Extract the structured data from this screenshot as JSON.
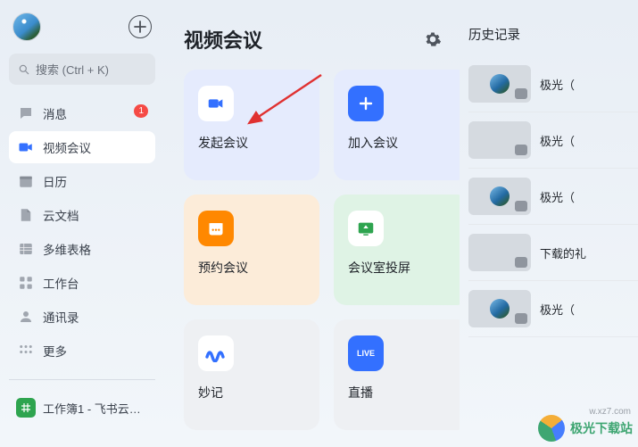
{
  "sidebar": {
    "search_placeholder": "搜索 (Ctrl + K)",
    "items": [
      {
        "label": "消息",
        "icon": "chat-icon",
        "badge": "1"
      },
      {
        "label": "视频会议",
        "icon": "video-icon",
        "active": true
      },
      {
        "label": "日历",
        "icon": "calendar-icon"
      },
      {
        "label": "云文档",
        "icon": "docs-icon"
      },
      {
        "label": "多维表格",
        "icon": "base-icon"
      },
      {
        "label": "工作台",
        "icon": "workplace-icon"
      },
      {
        "label": "通讯录",
        "icon": "contacts-icon"
      },
      {
        "label": "更多",
        "icon": "more-icon"
      }
    ],
    "workbook_label": "工作簿1 - 飞书云…"
  },
  "main": {
    "title": "视频会议",
    "cards": {
      "start": "发起会议",
      "join": "加入会议",
      "schedule": "预约会议",
      "cast": "会议室投屏",
      "notes": "妙记",
      "live": "直播",
      "live_badge": "LIVE"
    }
  },
  "history": {
    "title": "历史记录",
    "items": [
      {
        "label": "极光（",
        "has_avatar": true
      },
      {
        "label": "极光（",
        "has_avatar": false
      },
      {
        "label": "极光（",
        "has_avatar": true
      },
      {
        "label": "下载的礼",
        "has_avatar": false
      },
      {
        "label": "极光（",
        "has_avatar": true
      }
    ]
  },
  "watermark": {
    "text": "极光下载站",
    "sub": "w.xz7.com"
  }
}
